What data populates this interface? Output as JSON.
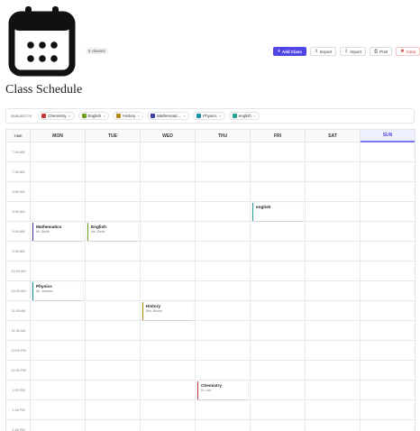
{
  "app": {
    "title": "Class Schedule",
    "class_count": "6 classes"
  },
  "toolbar": {
    "add_label": "Add Class",
    "export_label": "Export",
    "import_label": "Import",
    "print_label": "Print",
    "clear_label": "Clear"
  },
  "subjects": {
    "label": "SUBJECTS",
    "items": [
      {
        "name": "Chemistry",
        "color": "#c23a3a"
      },
      {
        "name": "English",
        "color": "#6f9d20"
      },
      {
        "name": "History",
        "color": "#b58a10"
      },
      {
        "name": "Mathematic...",
        "color": "#3f3fa8"
      },
      {
        "name": "Physics",
        "color": "#1c93a3"
      },
      {
        "name": "english",
        "color": "#27a396"
      }
    ]
  },
  "days": [
    {
      "name": "MON",
      "date": "",
      "today": false
    },
    {
      "name": "TUE",
      "date": "",
      "today": false
    },
    {
      "name": "WED",
      "date": "",
      "today": false
    },
    {
      "name": "THU",
      "date": "",
      "today": false
    },
    {
      "name": "FRI",
      "date": "",
      "today": false
    },
    {
      "name": "SAT",
      "date": "",
      "today": false
    },
    {
      "name": "SUN",
      "date": "",
      "today": true
    }
  ],
  "time_header": "TIME",
  "times": [
    "7:00 AM",
    "7:30 AM",
    "8:00 AM",
    "8:30 AM",
    "9:00 AM",
    "9:30 AM",
    "10:00 AM",
    "10:30 AM",
    "11:00 AM",
    "11:30 AM",
    "12:00 PM",
    "12:30 PM",
    "1:00 PM",
    "1:30 PM",
    "2:00 PM"
  ],
  "events": [
    {
      "name": "english",
      "instructor": "",
      "time": "",
      "day": 4,
      "slot": 3,
      "color": "#27a396"
    },
    {
      "name": "Mathematics",
      "instructor": "Mr. Smith",
      "time": "",
      "day": 0,
      "slot": 4,
      "color": "#3f3fa8"
    },
    {
      "name": "English",
      "instructor": "Ms. Davis",
      "time": "",
      "day": 1,
      "slot": 4,
      "color": "#6f9d20"
    },
    {
      "name": "Physics",
      "instructor": "Mr. Johnson",
      "time": "",
      "day": 0,
      "slot": 7,
      "color": "#1c93a3"
    },
    {
      "name": "History",
      "instructor": "Mrs. Brown",
      "time": "",
      "day": 2,
      "slot": 8,
      "color": "#b58a10"
    },
    {
      "name": "Chemistry",
      "instructor": "Dr. Lee",
      "time": "",
      "day": 3,
      "slot": 12,
      "color": "#c23a3a"
    }
  ]
}
